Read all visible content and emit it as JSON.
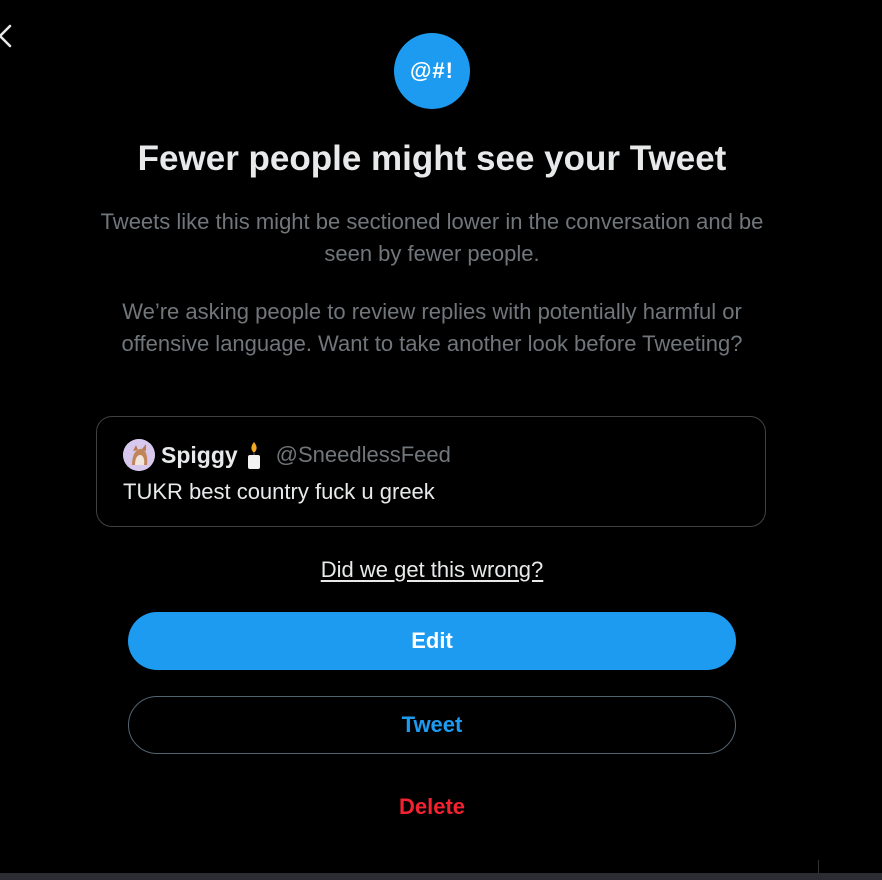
{
  "dialog": {
    "badge_text": "@#!",
    "title": "Fewer people might see your Tweet",
    "paragraph1": "Tweets like this might be sectioned lower in the conversation and be seen by fewer people.",
    "paragraph2": "We’re asking people to review replies with potentially harmful or offensive language. Want to take another look before Tweeting?"
  },
  "tweet": {
    "display_name": "Spiggy",
    "handle": "@SneedlessFeed",
    "text": "TUKR best country fuck u greek",
    "name_emoji_icon": "candle-icon"
  },
  "feedback_link": "Did we get this wrong?",
  "buttons": {
    "edit": "Edit",
    "tweet": "Tweet",
    "delete": "Delete"
  },
  "icons": {
    "close": "close-icon",
    "avatar": "avatar"
  },
  "colors": {
    "background": "#000000",
    "accent": "#1d9bf0",
    "danger": "#f4212e",
    "primary_text": "#e7e9ea",
    "secondary_text": "#71767b",
    "border": "#3e4144"
  }
}
